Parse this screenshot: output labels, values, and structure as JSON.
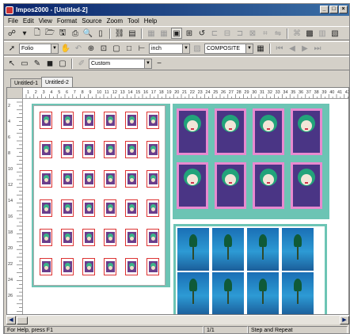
{
  "window": {
    "title": "Impos2000 - [Untitled-2]",
    "controls": [
      "_",
      "□",
      "×"
    ]
  },
  "menu": [
    "File",
    "Edit",
    "View",
    "Format",
    "Source",
    "Zoom",
    "Tool",
    "Help"
  ],
  "toolbar2": {
    "layout_select": "Folio",
    "unit_select": "inch",
    "color_select": "COMPOSITE"
  },
  "toolbar3": {
    "style_select": "Custom"
  },
  "tabs": [
    {
      "label": "Untitled-1",
      "active": false
    },
    {
      "label": "Untitled-2",
      "active": true
    }
  ],
  "ruler": {
    "top_numbers": [
      "1",
      "2",
      "3",
      "4",
      "5",
      "6",
      "7",
      "8",
      "9",
      "10",
      "11",
      "12",
      "13",
      "14",
      "15",
      "16",
      "17",
      "18",
      "19",
      "20",
      "21",
      "22",
      "23",
      "24",
      "25",
      "26",
      "27",
      "28",
      "29",
      "30",
      "31",
      "32",
      "33",
      "34",
      "35",
      "36",
      "37",
      "38",
      "39",
      "40",
      "41",
      "42"
    ],
    "left_numbers": [
      "2",
      "4",
      "6",
      "8",
      "10",
      "12",
      "14",
      "16",
      "18",
      "20",
      "22",
      "24",
      "26"
    ]
  },
  "grids": {
    "small_cells": {
      "rows": 6,
      "cols": 6
    },
    "posters": {
      "rows": 2,
      "cols": 4
    },
    "ocean_tiles": {
      "rows": 2,
      "cols": 4
    }
  },
  "colors": {
    "title_bar": "#0a246a",
    "sheet_bg": "#6cc4b4",
    "poster_border": "#e88ad0",
    "poster_art": "#4a3585"
  },
  "status": {
    "help": "For Help, press F1",
    "page": "1/1",
    "mode": "Step and Repeat"
  }
}
